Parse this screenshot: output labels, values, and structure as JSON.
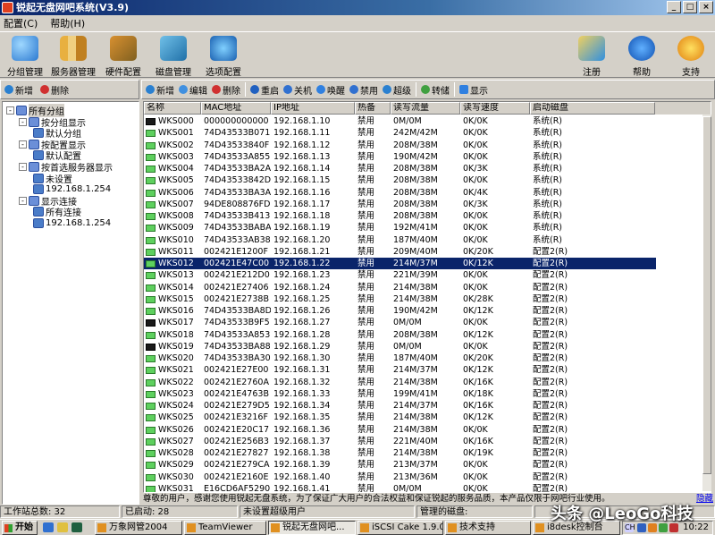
{
  "window": {
    "title": "锐起无盘网吧系统(V3.9)",
    "controls": {
      "minimize": "_",
      "maximize": "□",
      "close": "×"
    }
  },
  "menu": [
    "配置(C)",
    "帮助(H)"
  ],
  "toolbar": {
    "left": [
      "分组管理",
      "服务器管理",
      "硬件配置",
      "磁盘管理",
      "选项配置"
    ],
    "right": [
      "注册",
      "帮助",
      "支持"
    ]
  },
  "left_toolbar": [
    "新增",
    "删除"
  ],
  "right_toolbar": [
    "新增",
    "编辑",
    "删除",
    "重启",
    "关机",
    "唤醒",
    "禁用",
    "超级",
    "转储",
    "显示"
  ],
  "tree": [
    {
      "label": "所有分组",
      "level": 0,
      "expander": "-",
      "selected": true
    },
    {
      "label": "按分组显示",
      "level": 1,
      "expander": "-"
    },
    {
      "label": "默认分组",
      "level": 2
    },
    {
      "label": "按配置显示",
      "level": 1,
      "expander": "-"
    },
    {
      "label": "默认配置",
      "level": 2
    },
    {
      "label": "按首选服务器显示",
      "level": 1,
      "expander": "-"
    },
    {
      "label": "未设置",
      "level": 2
    },
    {
      "label": "192.168.1.254",
      "level": 2
    },
    {
      "label": "显示连接",
      "level": 1,
      "expander": "-"
    },
    {
      "label": "所有连接",
      "level": 2
    },
    {
      "label": "192.168.1.254",
      "level": 2
    }
  ],
  "table": {
    "columns": [
      "名称",
      "MAC地址",
      "IP地址",
      "热备",
      "读写流量",
      "读写速度",
      "启动磁盘"
    ],
    "rows": [
      [
        "WKS000",
        "000000000000",
        "192.168.1.10",
        "禁用",
        "0M/0M",
        "0K/0K",
        "系统(R)",
        "off"
      ],
      [
        "WKS001",
        "74D43533B071",
        "192.168.1.11",
        "禁用",
        "242M/42M",
        "0K/0K",
        "系统(R)",
        "on"
      ],
      [
        "WKS002",
        "74D43533840F",
        "192.168.1.12",
        "禁用",
        "208M/38M",
        "0K/0K",
        "系统(R)",
        "on"
      ],
      [
        "WKS003",
        "74D43533A855",
        "192.168.1.13",
        "禁用",
        "190M/42M",
        "0K/0K",
        "系统(R)",
        "on"
      ],
      [
        "WKS004",
        "74D43533BA2A",
        "192.168.1.14",
        "禁用",
        "208M/38M",
        "0K/3K",
        "系统(R)",
        "on"
      ],
      [
        "WKS005",
        "74D43533842D",
        "192.168.1.15",
        "禁用",
        "208M/38M",
        "0K/0K",
        "系统(R)",
        "on"
      ],
      [
        "WKS006",
        "74D43533BA3A",
        "192.168.1.16",
        "禁用",
        "208M/38M",
        "0K/4K",
        "系统(R)",
        "on"
      ],
      [
        "WKS007",
        "94DE808876FD",
        "192.168.1.17",
        "禁用",
        "208M/38M",
        "0K/3K",
        "系统(R)",
        "on"
      ],
      [
        "WKS008",
        "74D43533B413",
        "192.168.1.18",
        "禁用",
        "208M/38M",
        "0K/0K",
        "系统(R)",
        "on"
      ],
      [
        "WKS009",
        "74D43533BABA",
        "192.168.1.19",
        "禁用",
        "192M/41M",
        "0K/0K",
        "系统(R)",
        "on"
      ],
      [
        "WKS010",
        "74D43533AB38",
        "192.168.1.20",
        "禁用",
        "187M/40M",
        "0K/0K",
        "系统(R)",
        "on"
      ],
      [
        "WKS011",
        "002421E1200F",
        "192.168.1.21",
        "禁用",
        "209M/40M",
        "0K/20K",
        "配置2(R)",
        "on"
      ],
      [
        "WKS012",
        "002421E47C00",
        "192.168.1.22",
        "禁用",
        "214M/37M",
        "0K/12K",
        "配置2(R)",
        "on"
      ],
      [
        "WKS013",
        "002421E212D0",
        "192.168.1.23",
        "禁用",
        "221M/39M",
        "0K/0K",
        "配置2(R)",
        "on"
      ],
      [
        "WKS014",
        "002421E27406",
        "192.168.1.24",
        "禁用",
        "214M/38M",
        "0K/0K",
        "配置2(R)",
        "on"
      ],
      [
        "WKS015",
        "002421E2738B",
        "192.168.1.25",
        "禁用",
        "214M/38M",
        "0K/28K",
        "配置2(R)",
        "on"
      ],
      [
        "WKS016",
        "74D43533BA8D",
        "192.168.1.26",
        "禁用",
        "190M/42M",
        "0K/12K",
        "配置2(R)",
        "on"
      ],
      [
        "WKS017",
        "74D43533B9F5",
        "192.168.1.27",
        "禁用",
        "0M/0M",
        "0K/0K",
        "配置2(R)",
        "off"
      ],
      [
        "WKS018",
        "74D43533A853",
        "192.168.1.28",
        "禁用",
        "208M/38M",
        "0K/12K",
        "配置2(R)",
        "on"
      ],
      [
        "WKS019",
        "74D43533BA88",
        "192.168.1.29",
        "禁用",
        "0M/0M",
        "0K/0K",
        "配置2(R)",
        "off"
      ],
      [
        "WKS020",
        "74D43533BA30",
        "192.168.1.30",
        "禁用",
        "187M/40M",
        "0K/20K",
        "配置2(R)",
        "on"
      ],
      [
        "WKS021",
        "002421E27E00",
        "192.168.1.31",
        "禁用",
        "214M/37M",
        "0K/12K",
        "配置2(R)",
        "on"
      ],
      [
        "WKS022",
        "002421E2760A",
        "192.168.1.32",
        "禁用",
        "214M/38M",
        "0K/16K",
        "配置2(R)",
        "on"
      ],
      [
        "WKS023",
        "002421E4763B",
        "192.168.1.33",
        "禁用",
        "199M/41M",
        "0K/18K",
        "配置2(R)",
        "on"
      ],
      [
        "WKS024",
        "002421E279D5",
        "192.168.1.34",
        "禁用",
        "214M/37M",
        "0K/16K",
        "配置2(R)",
        "on"
      ],
      [
        "WKS025",
        "002421E3216F",
        "192.168.1.35",
        "禁用",
        "214M/38M",
        "0K/12K",
        "配置2(R)",
        "on"
      ],
      [
        "WKS026",
        "002421E20C17",
        "192.168.1.36",
        "禁用",
        "214M/38M",
        "0K/0K",
        "配置2(R)",
        "on"
      ],
      [
        "WKS027",
        "002421E256B3",
        "192.168.1.37",
        "禁用",
        "221M/40M",
        "0K/16K",
        "配置2(R)",
        "on"
      ],
      [
        "WKS028",
        "002421E27827",
        "192.168.1.38",
        "禁用",
        "214M/38M",
        "0K/19K",
        "配置2(R)",
        "on"
      ],
      [
        "WKS029",
        "002421E279CA",
        "192.168.1.39",
        "禁用",
        "213M/37M",
        "0K/0K",
        "配置2(R)",
        "on"
      ],
      [
        "WKS030",
        "002421E2160E",
        "192.168.1.40",
        "禁用",
        "213M/36M",
        "0K/0K",
        "配置2(R)",
        "on"
      ],
      [
        "WKS031",
        "E16CD6AF5290",
        "192.168.1.41",
        "禁用",
        "0M/0M",
        "0K/0K",
        "配置2(R)",
        "on"
      ]
    ],
    "selected_row": 12
  },
  "notice": {
    "text": "尊敬的用户，感谢您使用锐起无盘系统，为了保证广大用户的合法权益和保证锐起的服务品质，本产品仅限于网吧行业使用。",
    "link": "隐藏"
  },
  "status": [
    "工作站总数: 32",
    "已启动: 28",
    "未设置超级用户",
    "管理的磁盘:",
    ""
  ],
  "taskbar": {
    "start": "开始",
    "tasks": [
      {
        "label": "万象网管2004",
        "active": false
      },
      {
        "label": "TeamViewer",
        "active": false
      },
      {
        "label": "锐起无盘网吧...",
        "active": true
      },
      {
        "label": "iSCSI Cake 1.9.0...",
        "active": false
      },
      {
        "label": "技术支持",
        "active": false
      },
      {
        "label": "i8desk控制台",
        "active": false
      }
    ],
    "clock": "10:22",
    "lang": "CH"
  },
  "watermark": "头条 @LeoGo科技",
  "colors": {
    "titlebar": "#0a246a",
    "selection": "#0a246a",
    "window_bg": "#d4d0c8"
  }
}
